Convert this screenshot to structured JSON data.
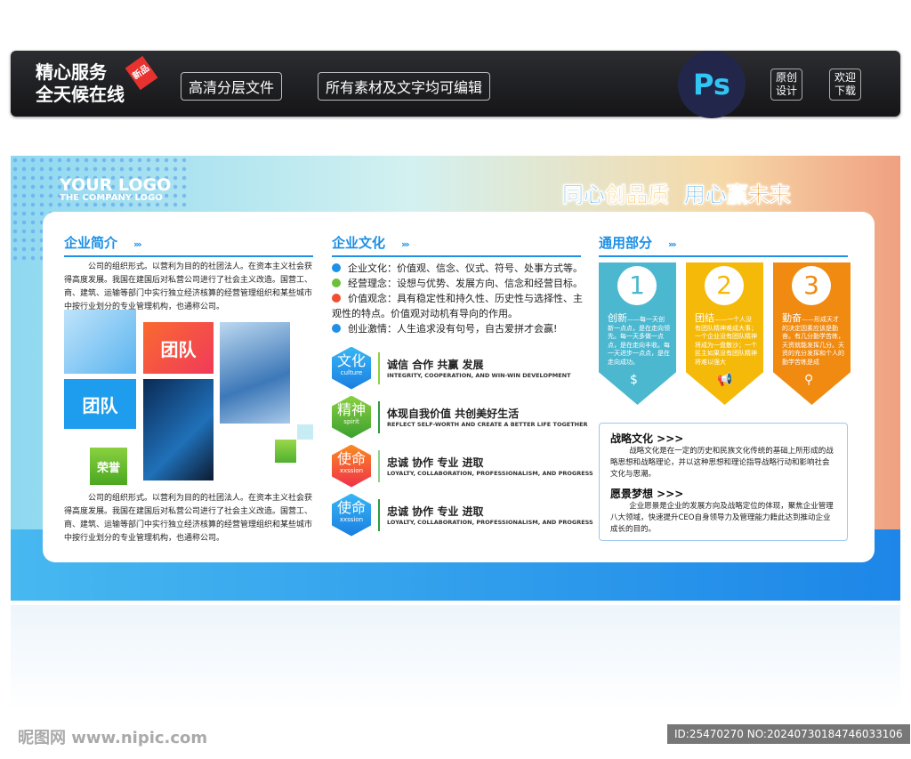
{
  "topbar": {
    "slogan_line1": "精心服务",
    "slogan_line2": "全天候在线",
    "new_tag": "新品",
    "pill1": "高清分层文件",
    "pill2": "所有素材及文字均可编辑",
    "ps_logo": "Ps",
    "btn_original": "原创设计",
    "btn_download": "欢迎下载"
  },
  "board": {
    "logo": "YOUR LOGO",
    "logo_sub": "THE COMPANY LOGO",
    "motto_a": "同心",
    "motto_b": "创品质",
    "motto_c": "用心",
    "motto_d": "赢未来"
  },
  "intro": {
    "title": "企业简介",
    "arrows": "›››",
    "para1": "公司的组织形式。以营利为目的的社团法人。在资本主义社会获得高度发展。我国在建国后对私营公司进行了社会主义改造。国营工、商、建筑、运输等部门中实行独立经济核算的经营管理组织和某些城市中按行业划分的专业管理机构，也通称公司。",
    "tile_red": "团队",
    "tile_blue": "团队",
    "tile_green": "荣誉",
    "para2": "公司的组织形式。以营利为目的的社团法人。在资本主义社会获得高度发展。我国在建国后对私营公司进行了社会主义改造。国营工、商、建筑、运输等部门中实行独立经济核算的经营管理组织和某些城市中按行业划分的专业管理机构，也通称公司。"
  },
  "culture": {
    "title": "企业文化",
    "arrows": "›››",
    "bullets": [
      {
        "text": "企业文化：价值观、信念、仪式、符号、处事方式等。",
        "color": "#1e90e8"
      },
      {
        "text": "经营理念：设想与优势、发展方向、信念和经营目标。",
        "color": "#6cc03a"
      },
      {
        "text": "价值观念：具有稳定性和持久性、历史性与选择性、主观性的特点。价值观对动机有导向的作用。",
        "color": "#f05030"
      },
      {
        "text": "创业激情：人生追求没有句号，自古爱拼才会赢!",
        "color": "#1e90e8"
      }
    ],
    "items": [
      {
        "hex": "文化",
        "hex_sub": "culture",
        "title": "诚信 合作 共赢 发展",
        "sub": "INTEGRITY, COOPERATION, AND WIN-WIN DEVELOPMENT"
      },
      {
        "hex": "精神",
        "hex_sub": "spirit",
        "title": "体现自我价值 共创美好生活",
        "sub": "REFLECT SELF-WORTH AND CREATE A BETTER LIFE TOGETHER"
      },
      {
        "hex": "使命",
        "hex_sub": "xxssion",
        "title": "忠诚 协作 专业 进取",
        "sub": "LOYALTY, COLLABORATION, PROFESSIONALISM, AND PROGRESS"
      },
      {
        "hex": "使命",
        "hex_sub": "xxssion",
        "title": "忠诚 协作 专业 进取",
        "sub": "LOYALTY, COLLABORATION, PROFESSIONALISM, AND PROGRESS"
      }
    ]
  },
  "general": {
    "title": "通用部分",
    "arrows": "›››",
    "cards": [
      {
        "num": "1",
        "head": "创新",
        "body": "——每一天创新一点点，是在走向领先。每一天多做一点点，是在走向丰收。每一天进步一点点，是在走向成功。",
        "color": "#4cb8d0"
      },
      {
        "num": "2",
        "head": "团结",
        "body": "——一个人没有团队精神难成大事；一个企业没有团队精神将成为一盘散沙；一个民主如果没有团队精神将难以强大",
        "color": "#f5b90a"
      },
      {
        "num": "3",
        "head": "勤奋",
        "body": "——形成天才的决定因素应该是勤奋。有几分勤学苦练，天资就能发挥几分。天资的充分发挥和个人的勤学苦练是成",
        "color": "#f08a10"
      }
    ],
    "strategy_title": "战略文化 >>>",
    "strategy_text": "战略文化是在一定的历史和民族文化传统的基础上所形成的战略思想和战略理论，并以这种思想和理论指导战略行动和影响社会文化与思潮。",
    "vision_title": "愿景梦想 >>>",
    "vision_text": "企业愿景是企业的发展方向及战略定位的体现，聚焦企业管理八大领域，快速提升CEO自身领导力及管理能力籍此达到推动企业成长的目的。"
  },
  "watermark": {
    "left": "昵图网 www.nipic.com",
    "right": "ID:25470270 NO:20240730184746033106"
  }
}
